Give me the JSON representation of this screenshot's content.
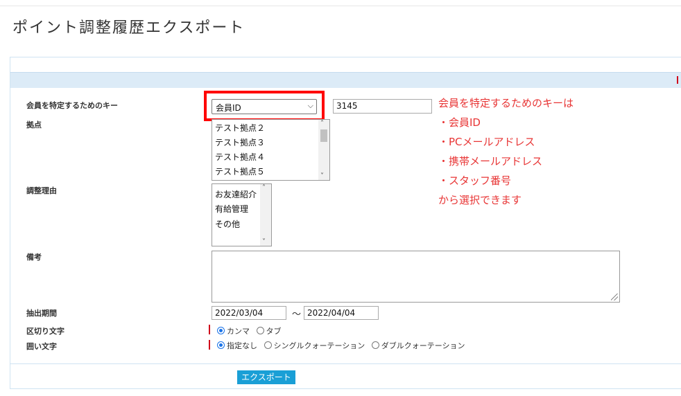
{
  "page": {
    "title": "ポイント調整履歴エクスポート"
  },
  "form": {
    "member_key": {
      "label": "会員を特定するためのキー",
      "selected": "会員ID",
      "value": "3145"
    },
    "location": {
      "label": "拠点",
      "options": [
        "テスト拠点２",
        "テスト拠点３",
        "テスト拠点４",
        "テスト拠点５"
      ]
    },
    "reason": {
      "label": "調整理由",
      "options": [
        "お友達紹介",
        "有給管理",
        "その他"
      ]
    },
    "remarks": {
      "label": "備考",
      "value": ""
    },
    "period": {
      "label": "抽出期間",
      "from": "2022/03/04",
      "separator": "〜",
      "to": "2022/04/04"
    },
    "delimiter": {
      "label": "区切り文字",
      "options": [
        {
          "label": "カンマ",
          "checked": true
        },
        {
          "label": "タブ",
          "checked": false
        }
      ]
    },
    "enclosure": {
      "label": "囲い文字",
      "options": [
        {
          "label": "指定なし",
          "checked": true
        },
        {
          "label": "シングルクォーテーション",
          "checked": false
        },
        {
          "label": "ダブルクォーテーション",
          "checked": false
        }
      ]
    },
    "export_label": "エクスポート"
  },
  "annotation": {
    "lines": [
      "会員を特定するためのキーは",
      "・会員ID",
      "・PCメールアドレス",
      "・携帯メールアドレス",
      "・スタッフ番号",
      "から選択できます"
    ],
    "highlight_color": "#ff0000",
    "text_color": "#e83535"
  }
}
